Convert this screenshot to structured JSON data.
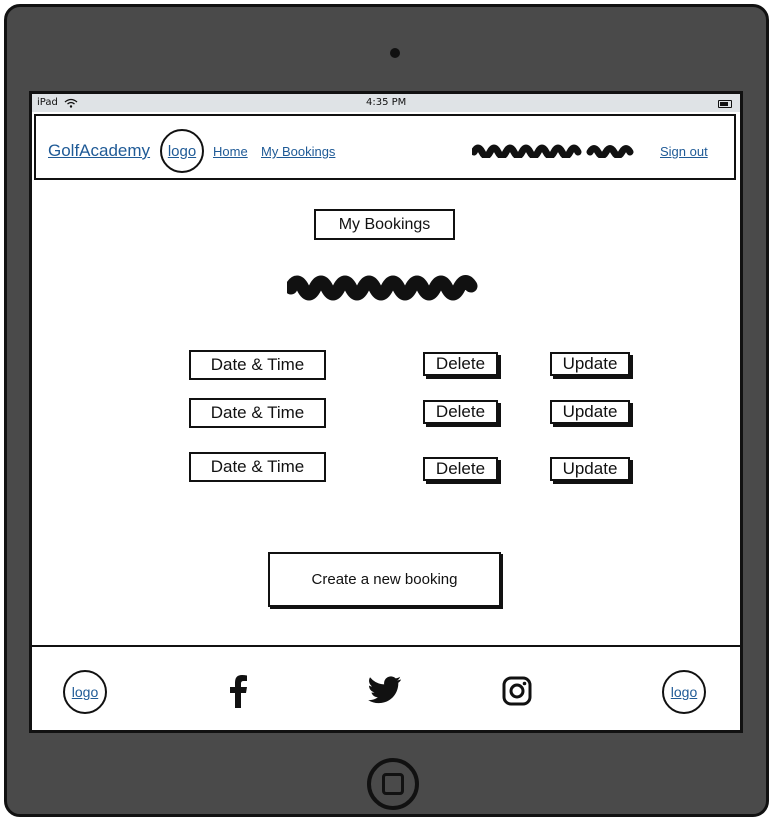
{
  "status_bar": {
    "device": "iPad",
    "time": "4:35 PM"
  },
  "nav": {
    "brand": "GolfAcademy",
    "logo": "logo",
    "home": "Home",
    "my_bookings": "My Bookings",
    "sign_out": "Sign out"
  },
  "page": {
    "title": "My Bookings"
  },
  "bookings": [
    {
      "datetime": "Date & Time",
      "delete": "Delete",
      "update": "Update"
    },
    {
      "datetime": "Date & Time",
      "delete": "Delete",
      "update": "Update"
    },
    {
      "datetime": "Date & Time",
      "delete": "Delete",
      "update": "Update"
    }
  ],
  "create_button": "Create a new booking",
  "footer": {
    "left_logo": "logo",
    "right_logo": "logo",
    "icons": [
      "facebook-icon",
      "twitter-icon",
      "instagram-icon"
    ]
  },
  "colors": {
    "link": "#1f5a96",
    "device_frame": "#4a4a4a",
    "status_bar": "#dfe3e6"
  }
}
